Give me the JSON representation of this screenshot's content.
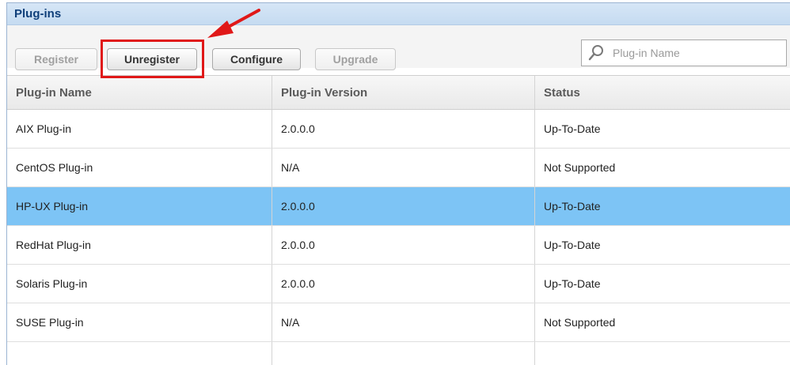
{
  "panel": {
    "title": "Plug-ins"
  },
  "toolbar": {
    "register_label": "Register",
    "unregister_label": "Unregister",
    "configure_label": "Configure",
    "upgrade_label": "Upgrade",
    "search_placeholder": "Plug-in Name"
  },
  "table": {
    "columns": [
      "Plug-in Name",
      "Plug-in Version",
      "Status"
    ],
    "rows": [
      {
        "name": "AIX Plug-in",
        "version": "2.0.0.0",
        "status": "Up-To-Date",
        "selected": false
      },
      {
        "name": "CentOS Plug-in",
        "version": "N/A",
        "status": "Not Supported",
        "selected": false
      },
      {
        "name": "HP-UX Plug-in",
        "version": "2.0.0.0",
        "status": "Up-To-Date",
        "selected": true
      },
      {
        "name": "RedHat Plug-in",
        "version": "2.0.0.0",
        "status": "Up-To-Date",
        "selected": false
      },
      {
        "name": "Solaris Plug-in",
        "version": "2.0.0.0",
        "status": "Up-To-Date",
        "selected": false
      },
      {
        "name": "SUSE Plug-in",
        "version": "N/A",
        "status": "Not Supported",
        "selected": false
      }
    ]
  },
  "colors": {
    "title_bar": "#c5dbf1",
    "title_text": "#0f3f7a",
    "selected_row": "#7dc4f5",
    "annotation": "#e01818"
  },
  "icons": {
    "search": "search-icon",
    "annotation_arrow": "arrow-icon"
  }
}
